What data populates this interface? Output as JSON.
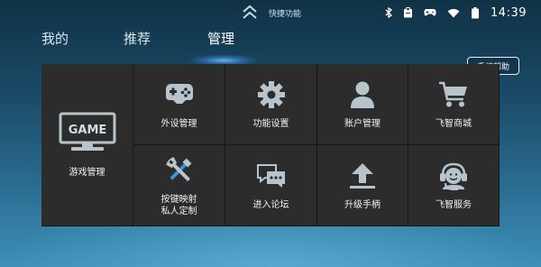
{
  "status_bar": {
    "quick_label": "快捷功能",
    "time": "14:39",
    "icons": [
      "chevron-up-icon",
      "bluetooth-icon",
      "clipboard-icon",
      "gamepad-icon",
      "wifi-icon",
      "battery-icon"
    ]
  },
  "tabs": [
    {
      "label": "我的",
      "active": false
    },
    {
      "label": "推荐",
      "active": false
    },
    {
      "label": "管理",
      "active": true
    }
  ],
  "help_button": "手柄帮助",
  "grid": {
    "game_management": {
      "label": "游戏管理",
      "icon_text": "GAME",
      "icon": "game-monitor-icon"
    },
    "items": [
      {
        "label": "外设管理",
        "icon": "gamepad-icon"
      },
      {
        "label": "功能设置",
        "icon": "gear-icon"
      },
      {
        "label": "账户管理",
        "icon": "user-icon"
      },
      {
        "label": "飞智商城",
        "icon": "shopping-cart-icon"
      },
      {
        "label_line1": "按键映射",
        "label_line2": "私人定制",
        "icon": "tools-icon"
      },
      {
        "label": "进入论坛",
        "icon": "chat-bubbles-icon"
      },
      {
        "label": "升级手柄",
        "icon": "upload-icon"
      },
      {
        "label": "飞智服务",
        "icon": "headset-support-icon"
      }
    ]
  },
  "colors": {
    "background_top": "#103245",
    "background_bottom": "#3d8fb8",
    "tile": "#2c2c2c",
    "tile_border": "#161616",
    "icon_fill": "#b8c4cc"
  }
}
